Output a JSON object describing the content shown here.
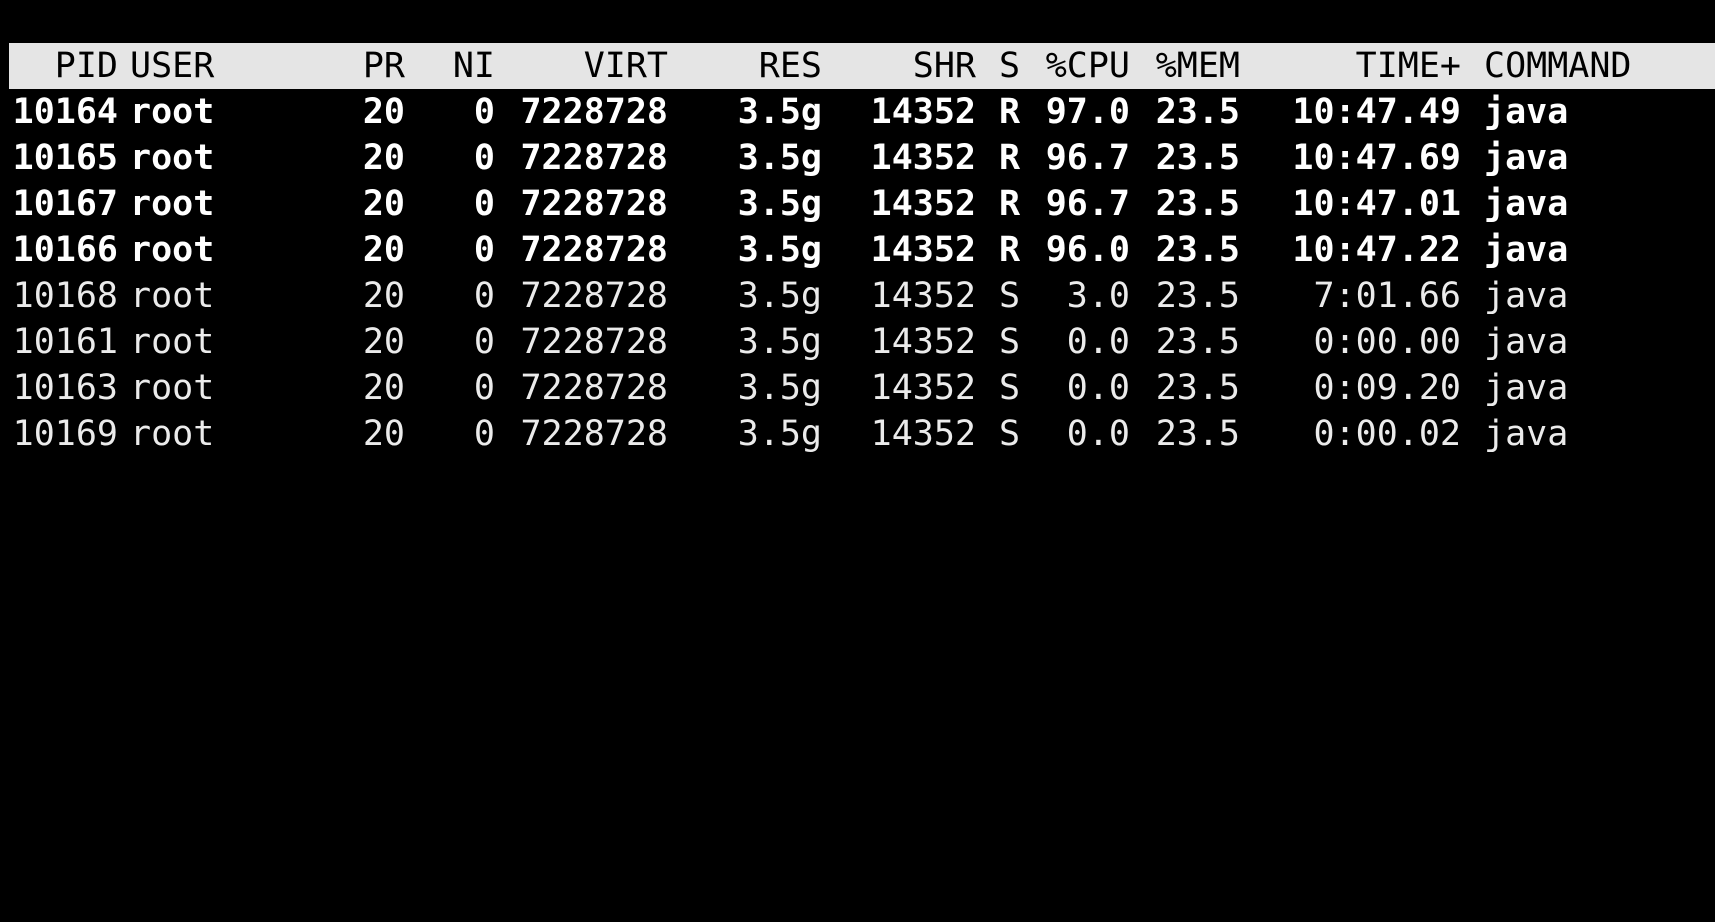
{
  "columns": {
    "pid": "PID",
    "user": "USER",
    "pr": "PR",
    "ni": "NI",
    "virt": "VIRT",
    "res": "RES",
    "shr": "SHR",
    "s": "S",
    "cpu": "%CPU",
    "mem": "%MEM",
    "time": "TIME+",
    "command": "COMMAND"
  },
  "rows": [
    {
      "pid": "10164",
      "user": "root",
      "pr": "20",
      "ni": "0",
      "virt": "7228728",
      "res": "3.5g",
      "shr": "14352",
      "s": "R",
      "cpu": "97.0",
      "mem": "23.5",
      "time": "10:47.49",
      "command": "java"
    },
    {
      "pid": "10165",
      "user": "root",
      "pr": "20",
      "ni": "0",
      "virt": "7228728",
      "res": "3.5g",
      "shr": "14352",
      "s": "R",
      "cpu": "96.7",
      "mem": "23.5",
      "time": "10:47.69",
      "command": "java"
    },
    {
      "pid": "10167",
      "user": "root",
      "pr": "20",
      "ni": "0",
      "virt": "7228728",
      "res": "3.5g",
      "shr": "14352",
      "s": "R",
      "cpu": "96.7",
      "mem": "23.5",
      "time": "10:47.01",
      "command": "java"
    },
    {
      "pid": "10166",
      "user": "root",
      "pr": "20",
      "ni": "0",
      "virt": "7228728",
      "res": "3.5g",
      "shr": "14352",
      "s": "R",
      "cpu": "96.0",
      "mem": "23.5",
      "time": "10:47.22",
      "command": "java"
    },
    {
      "pid": "10168",
      "user": "root",
      "pr": "20",
      "ni": "0",
      "virt": "7228728",
      "res": "3.5g",
      "shr": "14352",
      "s": "S",
      "cpu": "3.0",
      "mem": "23.5",
      "time": "7:01.66",
      "command": "java"
    },
    {
      "pid": "10161",
      "user": "root",
      "pr": "20",
      "ni": "0",
      "virt": "7228728",
      "res": "3.5g",
      "shr": "14352",
      "s": "S",
      "cpu": "0.0",
      "mem": "23.5",
      "time": "0:00.00",
      "command": "java"
    },
    {
      "pid": "10163",
      "user": "root",
      "pr": "20",
      "ni": "0",
      "virt": "7228728",
      "res": "3.5g",
      "shr": "14352",
      "s": "S",
      "cpu": "0.0",
      "mem": "23.5",
      "time": "0:09.20",
      "command": "java"
    },
    {
      "pid": "10169",
      "user": "root",
      "pr": "20",
      "ni": "0",
      "virt": "7228728",
      "res": "3.5g",
      "shr": "14352",
      "s": "S",
      "cpu": "0.0",
      "mem": "23.5",
      "time": "0:00.02",
      "command": "java"
    }
  ],
  "colors": {
    "background": "#000000",
    "header_background": "#e5e5e5",
    "header_text": "#000000",
    "running_text": "#ffffff",
    "sleeping_text": "#ebebeb"
  }
}
